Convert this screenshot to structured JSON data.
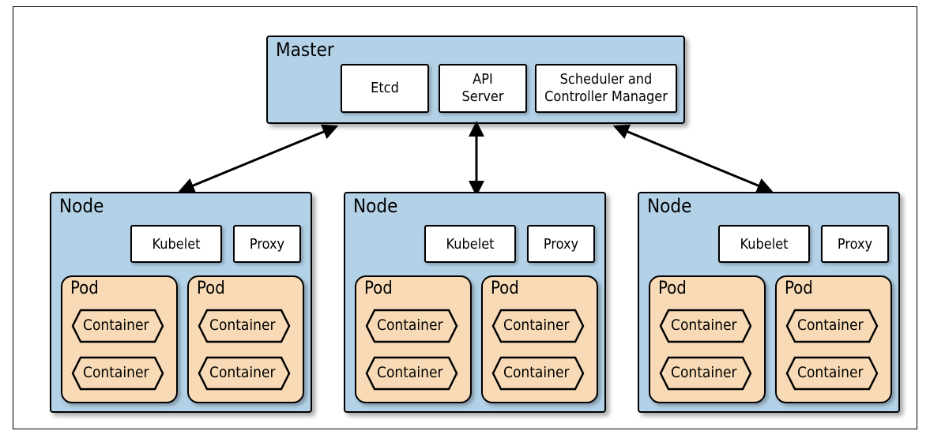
{
  "master": {
    "title": "Master",
    "components": {
      "etcd": "Etcd",
      "apiserver": "API\nServer",
      "scheduler": "Scheduler and\nController Manager"
    }
  },
  "node": {
    "title": "Node",
    "kubelet": "Kubelet",
    "proxy": "Proxy"
  },
  "pod": {
    "title": "Pod",
    "container": "Container"
  }
}
